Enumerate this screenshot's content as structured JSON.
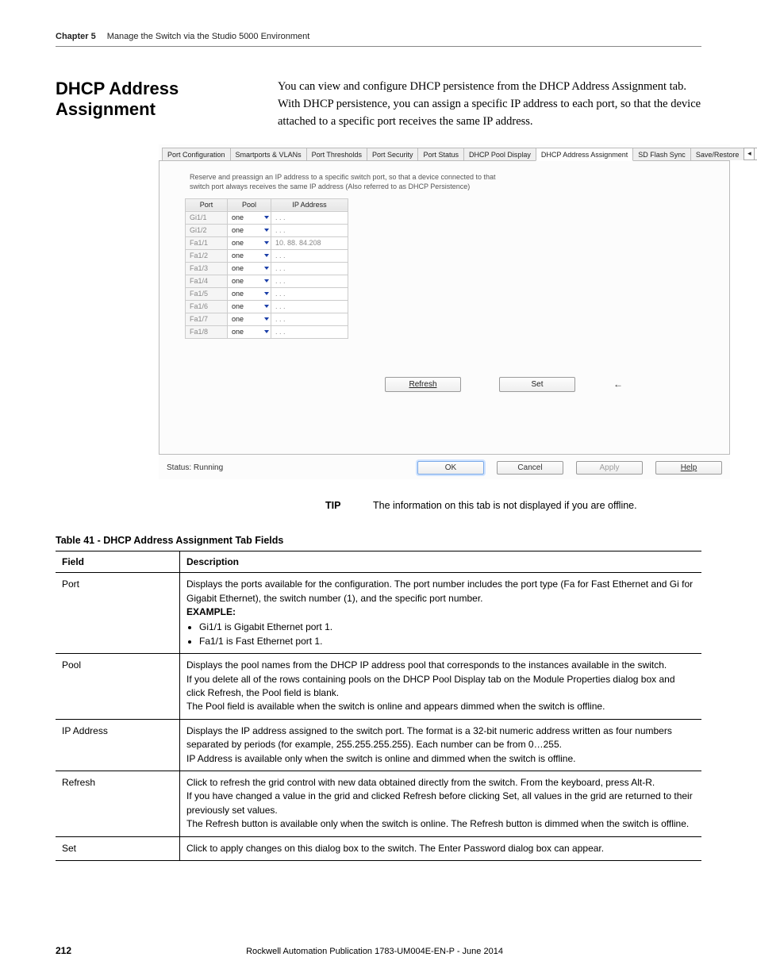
{
  "runhead": {
    "chapter": "Chapter 5",
    "title": "Manage the Switch via the Studio 5000 Environment"
  },
  "heading": "DHCP Address Assignment",
  "intro": "You can view and configure DHCP persistence from the DHCP Address Assignment tab. With DHCP persistence, you can assign a specific IP address to each port, so that the device attached to a specific port receives the same IP address.",
  "shot": {
    "tabs": [
      "Port Configuration",
      "Smartports & VLANs",
      "Port Thresholds",
      "Port Security",
      "Port Status",
      "DHCP Pool Display",
      "DHCP Address Assignment",
      "SD Flash Sync",
      "Save/Restore"
    ],
    "active_tab_index": 6,
    "nav_left": "◂",
    "nav_right": "▸",
    "blurb": "Reserve and preassign an IP address to a specific switch port, so that a device connected to that switch port always receives the same IP address (Also referred to as DHCP Persistence)",
    "grid_headers": {
      "port": "Port",
      "pool": "Pool",
      "ip": "IP Address"
    },
    "rows": [
      {
        "port": "Gi1/1",
        "pool": "one",
        "ip": ". . ."
      },
      {
        "port": "Gi1/2",
        "pool": "one",
        "ip": ". . ."
      },
      {
        "port": "Fa1/1",
        "pool": "one",
        "ip": "10. 88. 84.208"
      },
      {
        "port": "Fa1/2",
        "pool": "one",
        "ip": ". . ."
      },
      {
        "port": "Fa1/3",
        "pool": "one",
        "ip": ". . ."
      },
      {
        "port": "Fa1/4",
        "pool": "one",
        "ip": ". . ."
      },
      {
        "port": "Fa1/5",
        "pool": "one",
        "ip": ". . ."
      },
      {
        "port": "Fa1/6",
        "pool": "one",
        "ip": ". . ."
      },
      {
        "port": "Fa1/7",
        "pool": "one",
        "ip": ". . ."
      },
      {
        "port": "Fa1/8",
        "pool": "one",
        "ip": ". . ."
      }
    ],
    "buttons": {
      "refresh": "Refresh",
      "set": "Set",
      "back_arrow": "←"
    },
    "status_prefix": "Status:",
    "status_value": "Running",
    "footer_buttons": {
      "ok": "OK",
      "cancel": "Cancel",
      "apply": "Apply",
      "help": "Help"
    }
  },
  "tip": {
    "label": "TIP",
    "text": "The information on this tab is not displayed if you are offline."
  },
  "table_caption": "Table 41 - DHCP Address Assignment Tab Fields",
  "fields_header": {
    "field": "Field",
    "desc": "Description"
  },
  "fields": [
    {
      "name": "Port",
      "desc": "Displays the ports available for the configuration. The port number includes the port type (Fa for Fast Ethernet and Gi for Gigabit Ethernet), the switch number (1), and the specific port number.",
      "example_label": "EXAMPLE:",
      "bullets": [
        "Gi1/1 is Gigabit Ethernet port 1.",
        "Fa1/1 is Fast Ethernet port 1."
      ]
    },
    {
      "name": "Pool",
      "desc": "Displays the pool names from the DHCP IP address pool that corresponds to the instances available in the switch.",
      "extra": [
        "If you delete all of the rows containing pools on the DHCP Pool Display tab on the Module Properties dialog box and click Refresh, the Pool field is blank.",
        "The Pool field is available when the switch is online and appears dimmed when the switch is offline."
      ]
    },
    {
      "name": "IP Address",
      "desc": "Displays the IP address assigned to the switch port. The format is a 32-bit numeric address written as four numbers separated by periods (for example, 255.255.255.255). Each number can be from 0…255.",
      "extra": [
        "IP Address is available only when the switch is online and dimmed when the switch is offline."
      ]
    },
    {
      "name": "Refresh",
      "desc": "Click to refresh the grid control with new data obtained directly from the switch. From the keyboard, press Alt-R.",
      "extra": [
        "If you have changed a value in the grid and clicked Refresh before clicking Set, all values in the grid are returned to their previously set values.",
        "The Refresh button is available only when the switch is online. The Refresh button is dimmed when the switch is offline."
      ]
    },
    {
      "name": "Set",
      "desc": "Click to apply changes on this dialog box to the switch. The Enter Password dialog box can appear."
    }
  ],
  "footer": {
    "page": "212",
    "pub": "Rockwell Automation Publication 1783-UM004E-EN-P - June 2014"
  }
}
